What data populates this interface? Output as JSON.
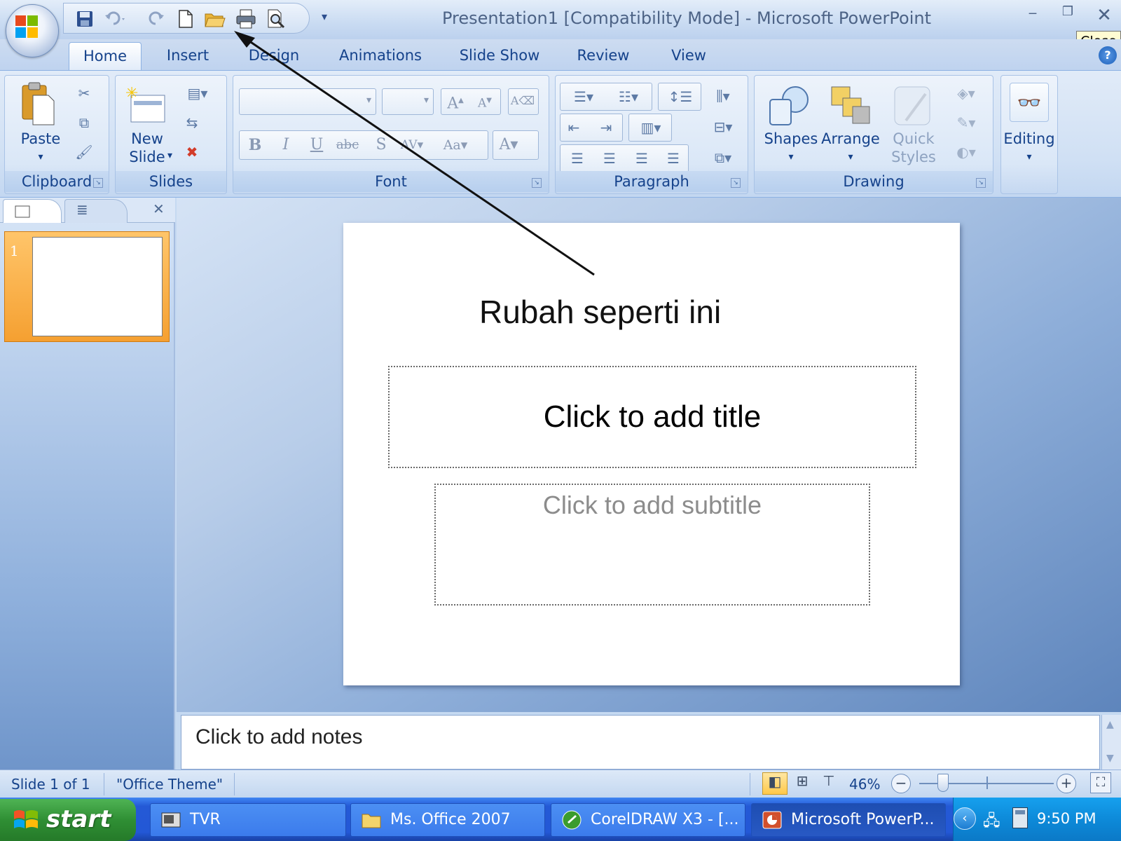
{
  "window": {
    "title": "Presentation1 [Compatibility Mode] - Microsoft PowerPoint",
    "tooltip": "Close"
  },
  "quick_access": {
    "icons": [
      "save-icon",
      "undo-icon",
      "redo-icon",
      "new-document-icon",
      "open-folder-icon",
      "print-icon",
      "print-preview-icon",
      "customize-dropdown-icon"
    ]
  },
  "tabs": [
    {
      "label": "Home",
      "active": true
    },
    {
      "label": "Insert"
    },
    {
      "label": "Design"
    },
    {
      "label": "Animations"
    },
    {
      "label": "Slide Show"
    },
    {
      "label": "Review"
    },
    {
      "label": "View"
    }
  ],
  "ribbon": {
    "clipboard": {
      "group_label": "Clipboard",
      "paste_label": "Paste"
    },
    "slides": {
      "group_label": "Slides",
      "new_slide_line1": "New",
      "new_slide_line2": "Slide"
    },
    "font": {
      "group_label": "Font",
      "font_name": "",
      "font_size": ""
    },
    "paragraph": {
      "group_label": "Paragraph"
    },
    "drawing": {
      "group_label": "Drawing",
      "shapes_label": "Shapes",
      "arrange_label": "Arrange",
      "quick_styles_line1": "Quick",
      "quick_styles_line2": "Styles"
    },
    "editing": {
      "label": "Editing"
    }
  },
  "slide_panel": {
    "slide_number": "1"
  },
  "slide": {
    "annotation": "Rubah seperti ini",
    "title_placeholder": "Click to add title",
    "subtitle_placeholder": "Click to add subtitle"
  },
  "notes": {
    "placeholder": "Click to add notes"
  },
  "status": {
    "slide_info": "Slide 1 of 1",
    "theme": "\"Office Theme\"",
    "zoom": "46%"
  },
  "taskbar": {
    "start": "start",
    "tasks": [
      {
        "label": "TVR"
      },
      {
        "label": "Ms. Office 2007"
      },
      {
        "label": "CorelDRAW X3 - [..."
      },
      {
        "label": "Microsoft PowerP...",
        "active": true
      }
    ],
    "clock": "9:50 PM"
  },
  "colors": {
    "ribbon_text": "#15428b",
    "taskbar_blue": "#2459d6",
    "start_green": "#2f8f34",
    "thumbnail_selected": "#f5a031"
  }
}
